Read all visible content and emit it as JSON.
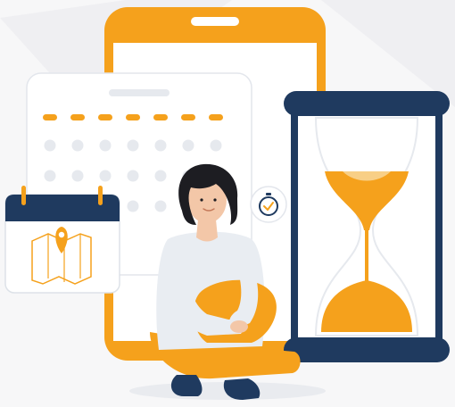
{
  "illustration": {
    "subject": "time-management",
    "icons": [
      "phone-icon",
      "calendar-grid-icon",
      "calendar-map-icon",
      "map-pin-icon",
      "hourglass-icon",
      "clock-check-icon",
      "woman-sitting-icon"
    ]
  },
  "colors": {
    "accent_orange": "#f5a11c",
    "navy": "#1f3a5f",
    "background": "#f7f7f8",
    "light_gray": "#e6e9ee",
    "white": "#ffffff",
    "hair": "#1d1d22",
    "skin": "#f3c7a8"
  }
}
